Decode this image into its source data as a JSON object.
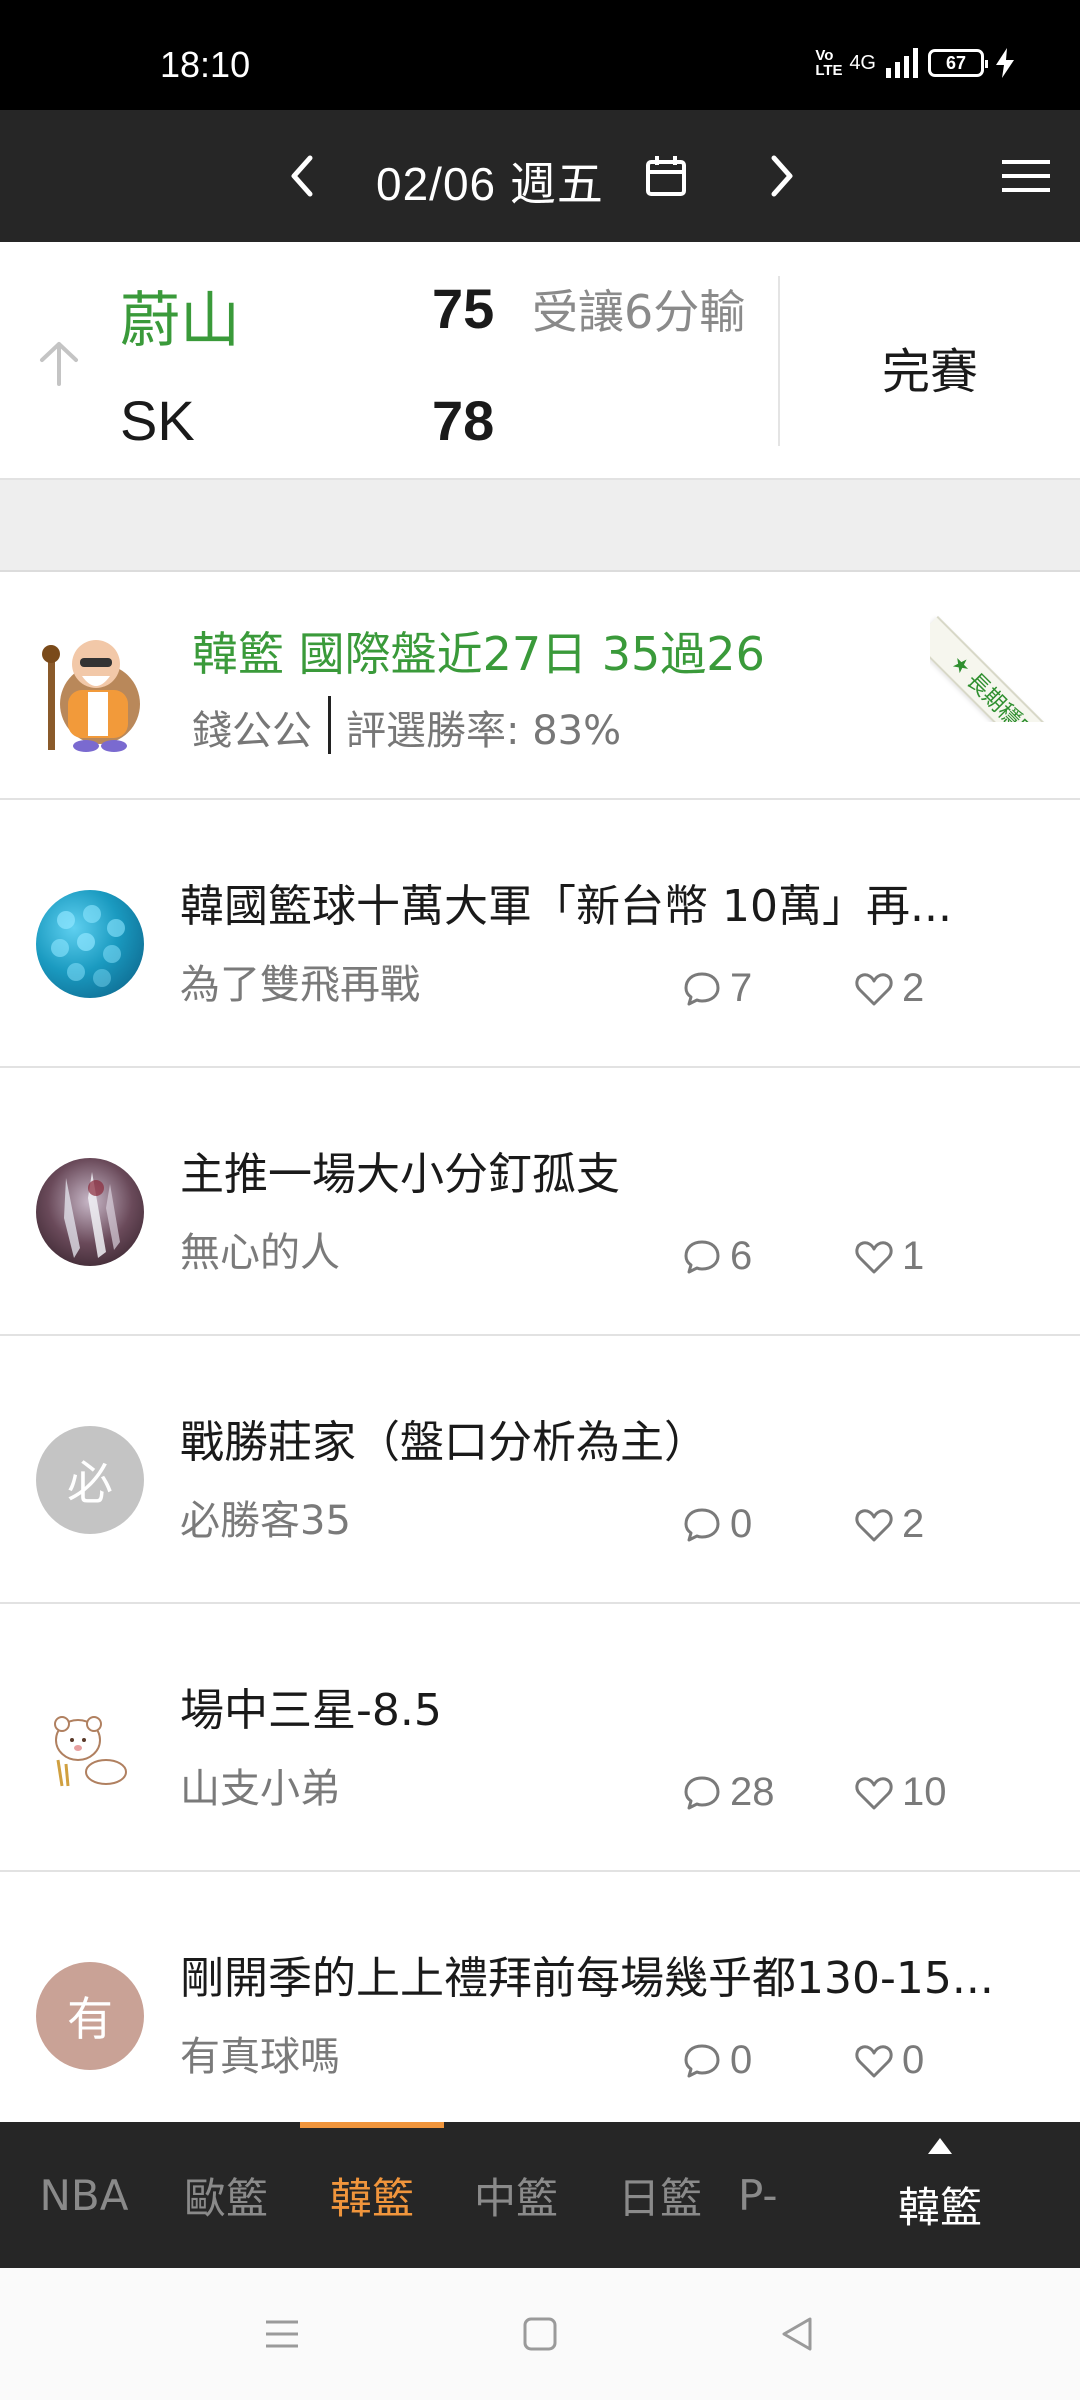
{
  "status_bar": {
    "time": "18:10",
    "volte": "Vo LTE",
    "network": "4G",
    "battery": "67"
  },
  "header": {
    "date": "02/06 週五"
  },
  "game": {
    "team1": {
      "name": "蔚山",
      "score": "75",
      "note": "受讓6分輸"
    },
    "team2": {
      "name": "SK",
      "score": "78"
    },
    "status": "完賽"
  },
  "featured": {
    "title": "韓籃 國際盤近27日 35過26",
    "name": "錢公公",
    "rate": "評選勝率: 83%",
    "ribbon": "長期穩定"
  },
  "posts": [
    {
      "title": "韓國籃球十萬大軍「新台幣 10萬」再...",
      "author": "為了雙飛再戰",
      "comments": "7",
      "likes": "2",
      "avatar_text": ""
    },
    {
      "title": "主推一場大小分釘孤支",
      "author": "無心的人",
      "comments": "6",
      "likes": "1",
      "avatar_text": ""
    },
    {
      "title": "戰勝莊家（盤口分析為主）",
      "author": "必勝客35",
      "comments": "0",
      "likes": "2",
      "avatar_text": "必"
    },
    {
      "title": "場中三星-8.5",
      "author": "山支小弟",
      "comments": "28",
      "likes": "10",
      "avatar_text": ""
    },
    {
      "title": "剛開季的上上禮拜前每場幾乎都130-15...",
      "author": "有真球嗎",
      "comments": "0",
      "likes": "0",
      "avatar_text": "有"
    }
  ],
  "league_tabs": [
    {
      "label": "NBA",
      "active": false
    },
    {
      "label": "歐籃",
      "active": false
    },
    {
      "label": "韓籃",
      "active": true
    },
    {
      "label": "中籃",
      "active": false
    },
    {
      "label": "日籃",
      "active": false
    },
    {
      "label": "P-",
      "active": false
    }
  ],
  "current_league": "韓籃",
  "colors": {
    "header_bg": "#262626",
    "green": "#3a9a3a",
    "accent_orange": "#f0953c"
  }
}
